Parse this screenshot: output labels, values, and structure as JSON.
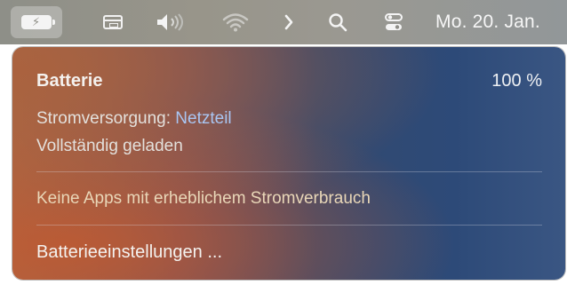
{
  "menubar": {
    "date": "Mo. 20. Jan.",
    "icons": [
      "battery-charging-icon",
      "display-icon",
      "volume-icon",
      "wifi-icon",
      "chevron-right-icon",
      "search-icon",
      "control-center-icon"
    ]
  },
  "battery_menu": {
    "title": "Batterie",
    "percent": "100 %",
    "power_source_label": "Stromversorgung: ",
    "power_source_value": "Netzteil",
    "status": "Vollständig geladen",
    "no_apps": "Keine Apps mit erheblichem Stromverbrauch",
    "settings_link": "Batterieeinstellungen ..."
  },
  "colors": {
    "accent_text": "#a9c6f3",
    "warning_text": "#e9d7b8"
  }
}
